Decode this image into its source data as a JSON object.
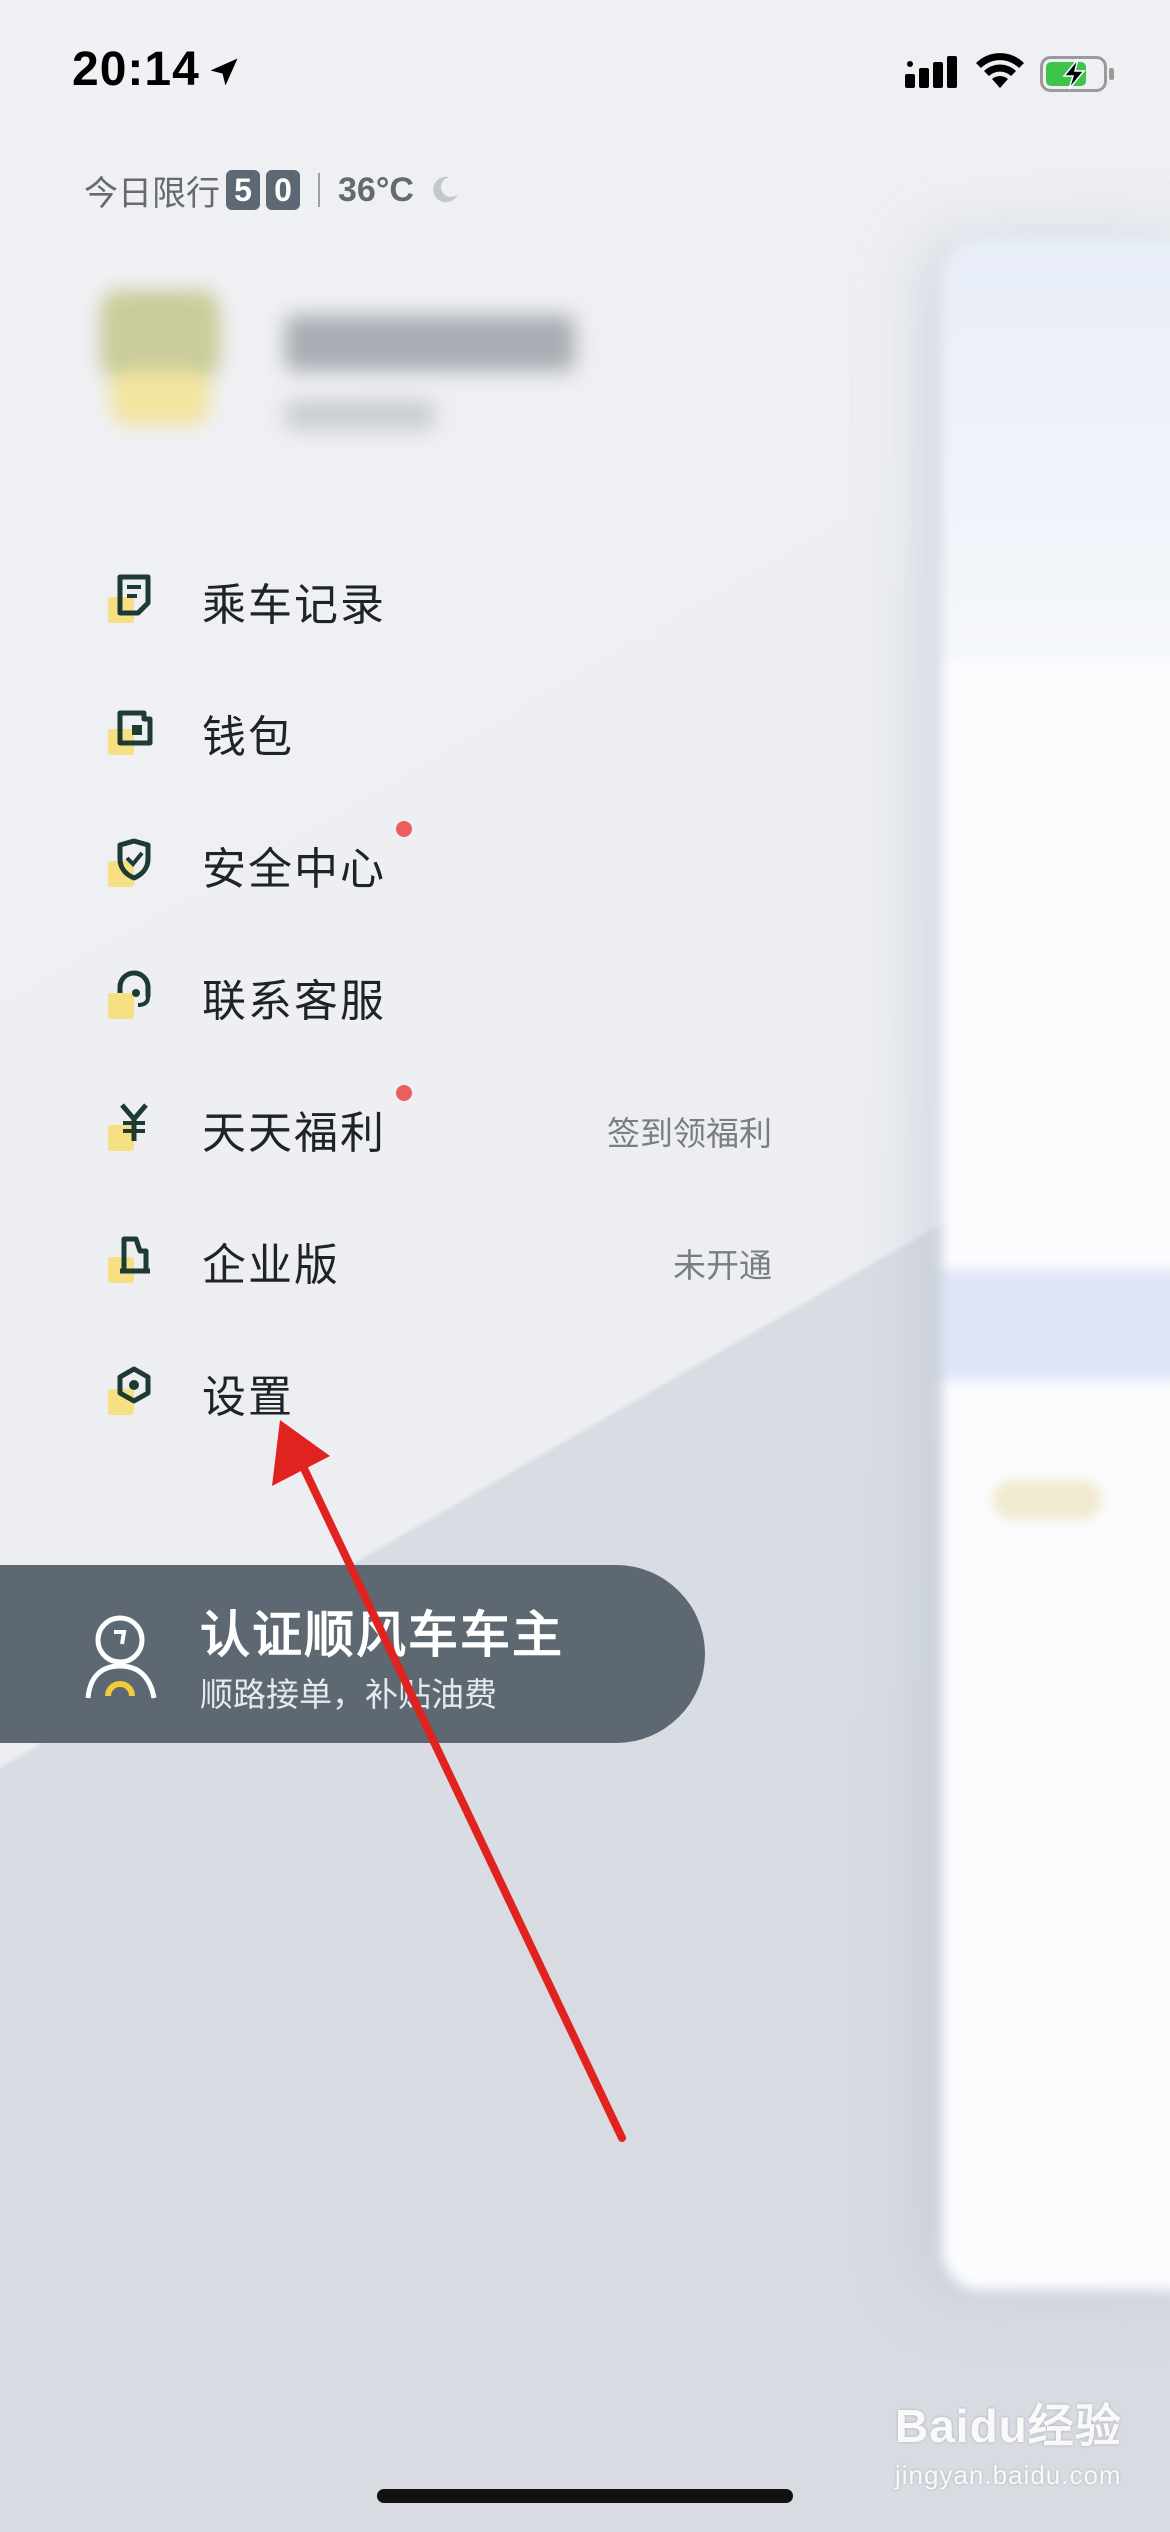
{
  "status_bar": {
    "time": "20:14"
  },
  "info": {
    "restriction_label": "今日限行",
    "restriction_digits": [
      "5",
      "0"
    ],
    "temperature": "36°C"
  },
  "menu": {
    "items": [
      {
        "label": "乘车记录",
        "icon": "ride-record-icon",
        "hint": "",
        "badge": false
      },
      {
        "label": "钱包",
        "icon": "wallet-icon",
        "hint": "",
        "badge": false
      },
      {
        "label": "安全中心",
        "icon": "shield-icon",
        "hint": "",
        "badge": true
      },
      {
        "label": "联系客服",
        "icon": "headset-icon",
        "hint": "",
        "badge": false
      },
      {
        "label": "天天福利",
        "icon": "yen-icon",
        "hint": "签到领福利",
        "badge": true
      },
      {
        "label": "企业版",
        "icon": "building-icon",
        "hint": "未开通",
        "badge": false
      },
      {
        "label": "设置",
        "icon": "settings-icon",
        "hint": "",
        "badge": false
      }
    ]
  },
  "driver_banner": {
    "title": "认证顺风车车主",
    "subtitle": "顺路接单，补贴油费"
  },
  "watermark": {
    "brand": "Baidu经验",
    "url": "jingyan.baidu.com"
  },
  "colors": {
    "accent_yellow": "#f7df84",
    "icon_dark": "#1e3b33",
    "badge_red": "#ec5d5d",
    "banner_bg": "#5e6873",
    "annotation_red": "#e0231f"
  }
}
